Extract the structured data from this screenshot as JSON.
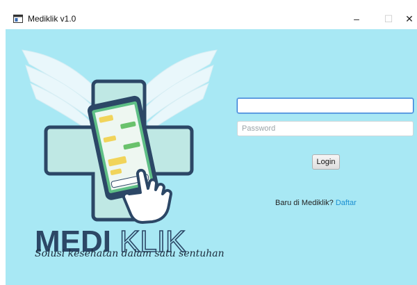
{
  "window": {
    "title": "Mediklik v1.0",
    "controls": {
      "minimize": "–",
      "maximize": "☐",
      "close": "✕"
    }
  },
  "brand": {
    "logo_text_bold": "MEDI",
    "logo_text_outline": "KLIK",
    "tagline": "Solusi kesehatan dalam satu sentuhan"
  },
  "form": {
    "username_value": "",
    "password_placeholder": "Password",
    "login_label": "Login",
    "signup_prompt": "Baru di Mediklik?",
    "signup_link": "Daftar"
  },
  "colors": {
    "background": "#a8e8f4",
    "brand_navy": "#2c4766",
    "link": "#1a8fd1"
  }
}
